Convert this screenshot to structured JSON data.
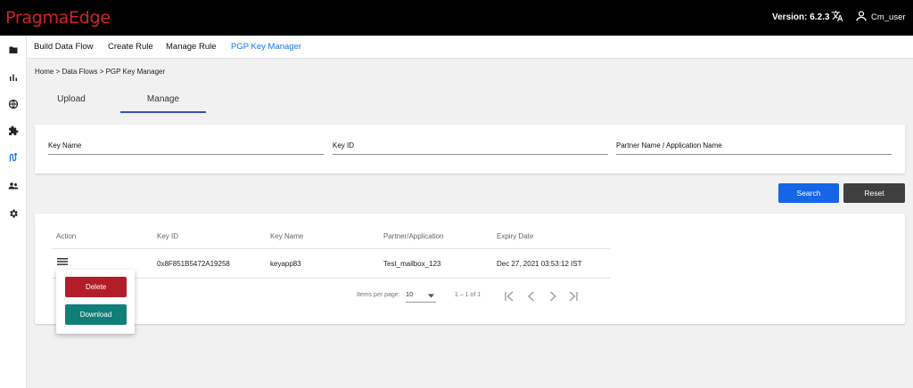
{
  "header": {
    "brand": "PragmaEdge",
    "version": "Version: 6.2.3",
    "username": "Cm_user"
  },
  "sidebar": {
    "icons": [
      "folder-icon",
      "bar-chart-icon",
      "globe-icon",
      "puzzle-icon",
      "route-icon",
      "group-icon",
      "settings-icon"
    ]
  },
  "nav": {
    "items": [
      {
        "label": "Build Data Flow"
      },
      {
        "label": "Create Rule"
      },
      {
        "label": "Manage Rule"
      },
      {
        "label": "PGP Key Manager",
        "active": true
      }
    ]
  },
  "breadcrumb": "Home > Data Flows > PGP Key Manager",
  "tabs": [
    {
      "label": "Upload"
    },
    {
      "label": "Manage",
      "active": true
    }
  ],
  "filters": {
    "key_name": "Key Name",
    "key_id": "Key ID",
    "partner_name": "Partner Name / Application Name"
  },
  "buttons": {
    "search": "Search",
    "reset": "Reset"
  },
  "table": {
    "columns": [
      "Action",
      "Key ID",
      "Key Name",
      "Partner/Application",
      "Expiry Date"
    ],
    "rows": [
      {
        "key_id": "0x8F851B5472A19258",
        "key_name": "keyapp83",
        "partner": "Test_mailbox_123",
        "expiry": "Dec 27, 2021 03:53:12 IST"
      }
    ]
  },
  "paginator": {
    "items_per_page_label": "Items per page:",
    "page_size": "10",
    "range": "1 – 1 of 1"
  },
  "action_menu": {
    "delete": "Delete",
    "download": "Download"
  },
  "colors": {
    "brand": "#d0232b",
    "accent": "#1a73e8",
    "search_button": "#1565e8",
    "reset_button": "#3f3f3f",
    "delete_button": "#b31d28",
    "download_button": "#0f7f78"
  }
}
